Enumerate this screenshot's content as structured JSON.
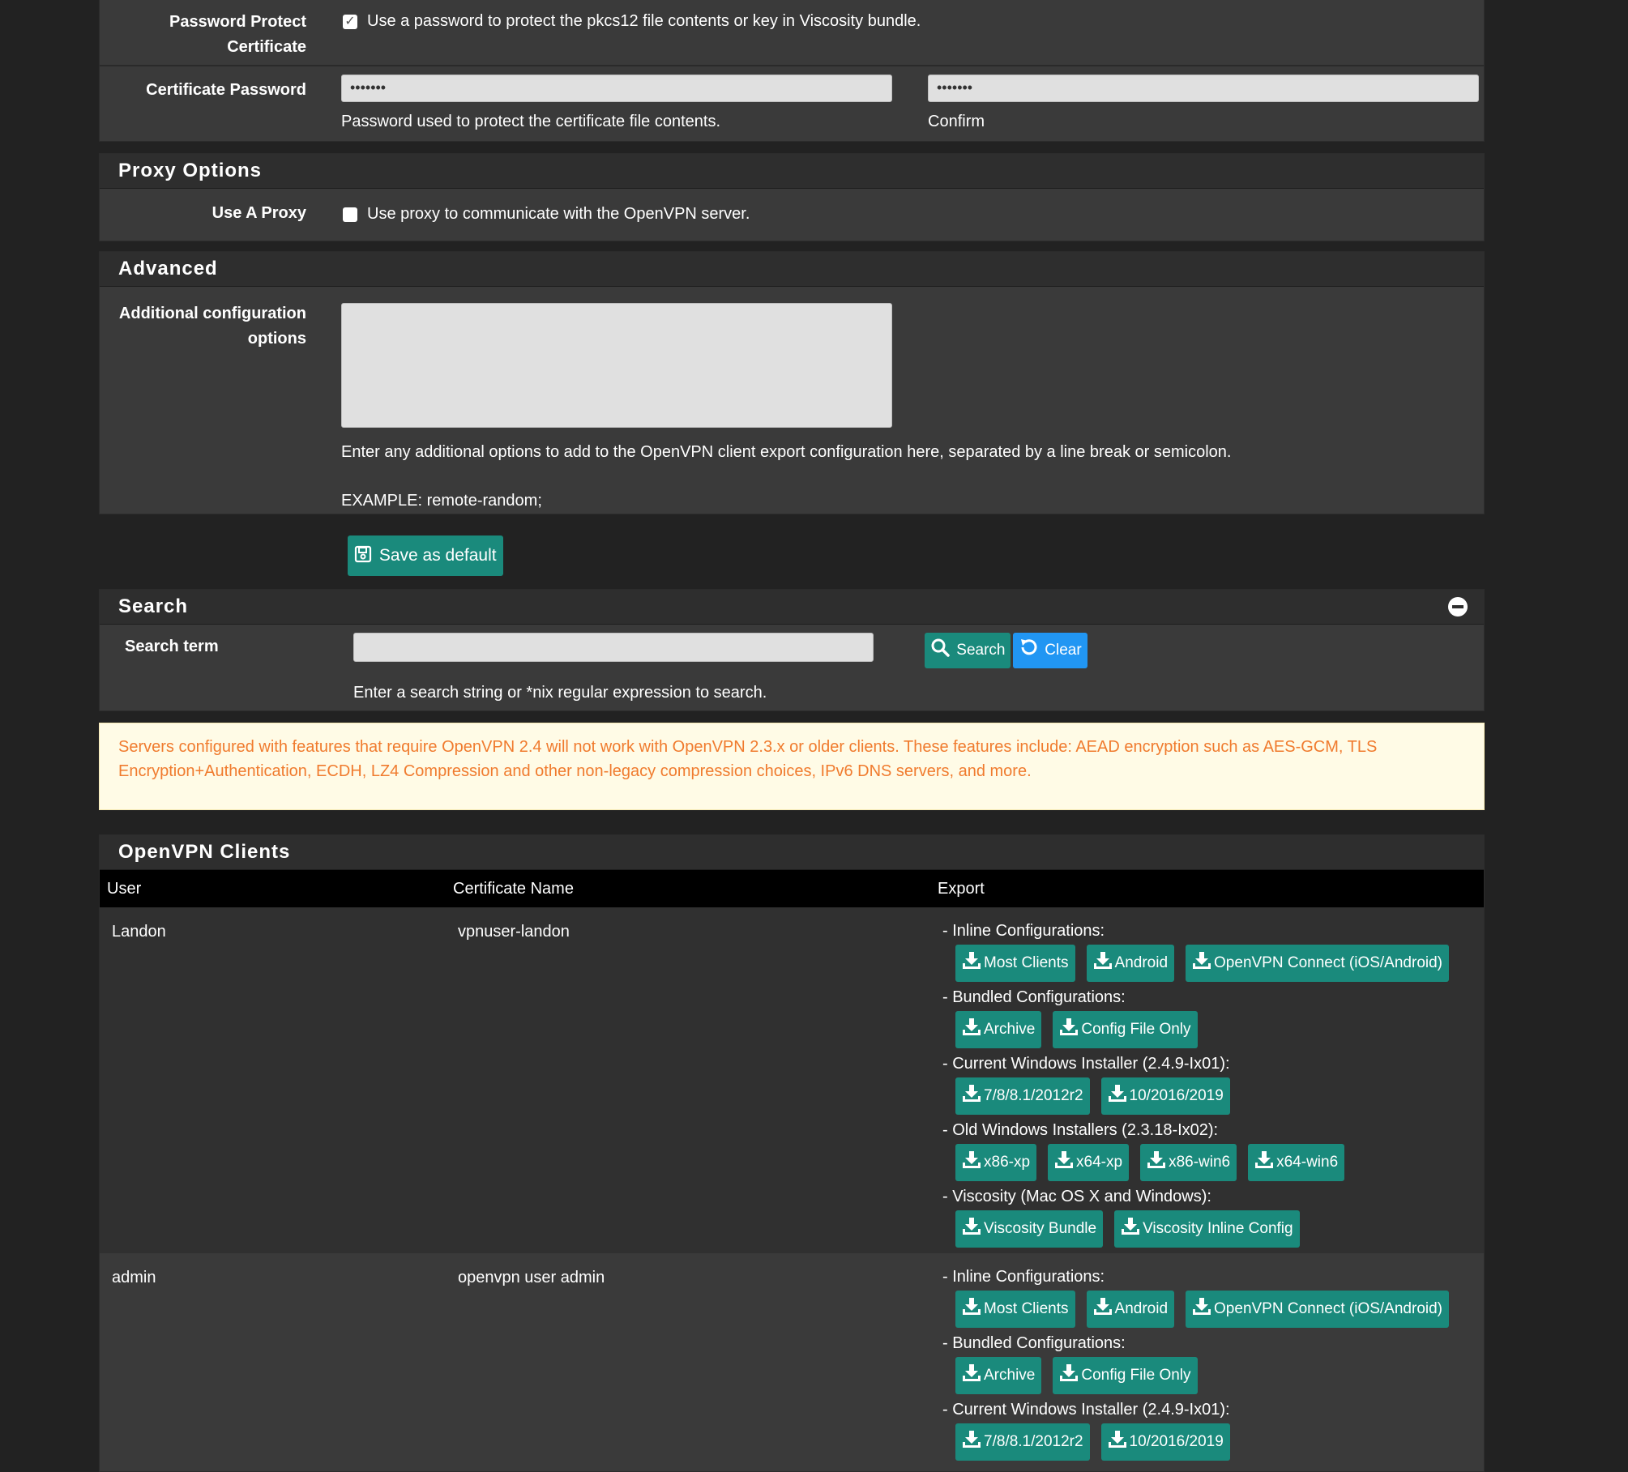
{
  "password_protect": {
    "label": "Password Protect Certificate",
    "label_line1": "Password Protect",
    "label_line2": "Certificate",
    "checked": true,
    "description": "Use a password to protect the pkcs12 file contents or key in Viscosity bundle."
  },
  "certificate_password": {
    "label": "Certificate Password",
    "value": "•••••••",
    "confirm_value": "•••••••",
    "help": "Password used to protect the certificate file contents.",
    "confirm_help": "Confirm"
  },
  "proxy": {
    "title": "Proxy Options",
    "label": "Use A Proxy",
    "checked": false,
    "description": "Use proxy to communicate with the OpenVPN server."
  },
  "advanced": {
    "title": "Advanced",
    "label_line1": "Additional configuration",
    "label_line2": "options",
    "value": "",
    "help": "Enter any additional options to add to the OpenVPN client export configuration here, separated by a line break or semicolon.",
    "example": "EXAMPLE: remote-random;"
  },
  "save_button": {
    "label": "Save as default",
    "icon": "save-icon"
  },
  "search": {
    "title": "Search",
    "label": "Search term",
    "value": "",
    "help": "Enter a search string or *nix regular expression to search.",
    "search_label": "Search",
    "clear_label": "Clear",
    "colors": {
      "search": "#1a8a7c",
      "clear": "#2196f3"
    }
  },
  "alert": {
    "text": "Servers configured with features that require OpenVPN 2.4 will not work with OpenVPN 2.3.x or older clients. These features include: AEAD encryption such as AES-GCM, TLS Encryption+Authentication, ECDH, LZ4 Compression and other non-legacy compression choices, IPv6 DNS servers, and more.",
    "color": "#f07b2e"
  },
  "clients": {
    "title": "OpenVPN Clients",
    "columns": [
      "User",
      "Certificate Name",
      "Export"
    ],
    "rows": [
      {
        "user": "Landon",
        "cert": "vpnuser-landon",
        "groups": [
          {
            "label": "- Inline Configurations:",
            "buttons": [
              "Most Clients",
              "Android",
              "OpenVPN Connect (iOS/Android)"
            ]
          },
          {
            "label": "- Bundled Configurations:",
            "buttons": [
              "Archive",
              "Config File Only"
            ]
          },
          {
            "label": "- Current Windows Installer (2.4.9-Ix01):",
            "buttons": [
              "7/8/8.1/2012r2",
              "10/2016/2019"
            ]
          },
          {
            "label": "- Old Windows Installers (2.3.18-Ix02):",
            "buttons": [
              "x86-xp",
              "x64-xp",
              "x86-win6",
              "x64-win6"
            ]
          },
          {
            "label": "- Viscosity (Mac OS X and Windows):",
            "buttons": [
              "Viscosity Bundle",
              "Viscosity Inline Config"
            ]
          }
        ]
      },
      {
        "user": "admin",
        "cert": "openvpn user admin",
        "groups": [
          {
            "label": "- Inline Configurations:",
            "buttons": [
              "Most Clients",
              "Android",
              "OpenVPN Connect (iOS/Android)"
            ]
          },
          {
            "label": "- Bundled Configurations:",
            "buttons": [
              "Archive",
              "Config File Only"
            ]
          },
          {
            "label": "- Current Windows Installer (2.4.9-Ix01):",
            "buttons": [
              "7/8/8.1/2012r2",
              "10/2016/2019"
            ]
          }
        ]
      }
    ]
  },
  "colors": {
    "accent": "#1a8a7c",
    "background": "#222222",
    "panel": "#3a3a3a"
  }
}
